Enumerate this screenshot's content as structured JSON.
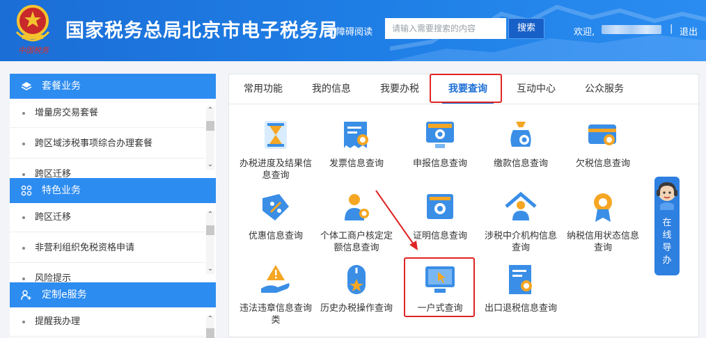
{
  "header": {
    "title": "国家税务总局北京市电子税务局",
    "seal_text": "中国税务",
    "accessible_reading": "无障碍阅读",
    "search_placeholder": "请输入需要搜索的内容",
    "search_button": "搜索",
    "welcome": "欢迎,",
    "separator": "|",
    "logout": "退出"
  },
  "sidebar": {
    "sections": [
      {
        "title": "套餐业务",
        "icon": "layers-icon",
        "items": [
          "增量房交易套餐",
          "跨区域涉税事项综合办理套餐",
          "跨区迁移"
        ]
      },
      {
        "title": "特色业务",
        "icon": "grid-icon",
        "items": [
          "跨区迁移",
          "非营利组织免税资格申请",
          "风险提示"
        ]
      },
      {
        "title": "定制e服务",
        "icon": "user-plus-icon",
        "items": [
          "提醒我办理"
        ]
      }
    ]
  },
  "tabs": [
    {
      "label": "常用功能",
      "active": false
    },
    {
      "label": "我的信息",
      "active": false
    },
    {
      "label": "我要办税",
      "active": false
    },
    {
      "label": "我要查询",
      "active": true
    },
    {
      "label": "互动中心",
      "active": false
    },
    {
      "label": "公众服务",
      "active": false
    }
  ],
  "functions": [
    {
      "label": "办税进度及结果信息查询",
      "icon": "hourglass-icon"
    },
    {
      "label": "发票信息查询",
      "icon": "invoice-search-icon"
    },
    {
      "label": "申报信息查询",
      "icon": "monitor-search-icon"
    },
    {
      "label": "缴款信息查询",
      "icon": "money-bag-search-icon"
    },
    {
      "label": "欠税信息查询",
      "icon": "card-search-icon"
    },
    {
      "label": "优惠信息查询",
      "icon": "discount-tag-icon"
    },
    {
      "label": "个体工商户核定定额信息查询",
      "icon": "person-search-icon"
    },
    {
      "label": "证明信息查询",
      "icon": "certificate-search-icon"
    },
    {
      "label": "涉税中介机构信息查询",
      "icon": "house-person-icon"
    },
    {
      "label": "纳税信用状态信息查询",
      "icon": "medal-icon"
    },
    {
      "label": "违法违章信息查询类",
      "icon": "warning-hand-icon"
    },
    {
      "label": "历史办税操作查询",
      "icon": "mouse-star-icon"
    },
    {
      "label": "一户式查询",
      "icon": "monitor-cursor-icon"
    },
    {
      "label": "出口退税信息查询",
      "icon": "export-doc-search-icon"
    }
  ],
  "guide": {
    "text": "在线导办"
  },
  "colors": {
    "brand_blue": "#1b6ed6",
    "sidebar_blue": "#2d8cf0",
    "highlight_red": "#e02424"
  }
}
